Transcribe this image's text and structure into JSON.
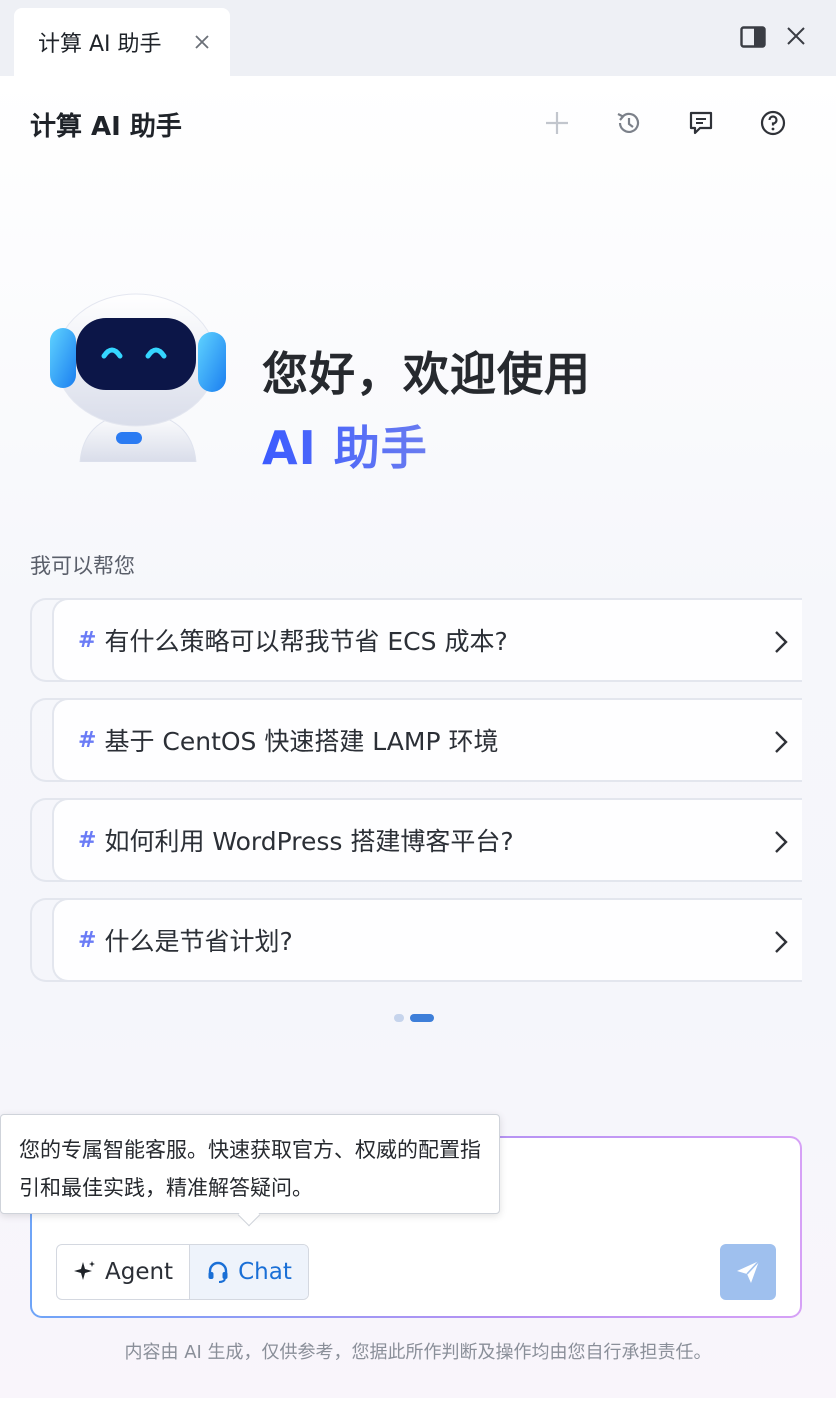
{
  "tab": {
    "title": "计算 AI 助手"
  },
  "header": {
    "title": "计算 AI 助手"
  },
  "welcome": {
    "line1": "您好，欢迎使用",
    "line2": "AI 助手"
  },
  "help_label": "我可以帮您",
  "suggestions": [
    {
      "hash": "#",
      "text": "有什么策略可以帮我节省 ECS 成本?"
    },
    {
      "hash": "#",
      "text": "基于 CentOS 快速搭建 LAMP 环境"
    },
    {
      "hash": "#",
      "text": "如何利用 WordPress 搭建博客平台?"
    },
    {
      "hash": "#",
      "text": "什么是节省计划?"
    }
  ],
  "pagination": {
    "pages": 2,
    "active": 2
  },
  "tooltip": {
    "text": "您的专属智能客服。快速获取官方、权威的配置指引和最佳实践，精准解答疑问。"
  },
  "modes": {
    "agent_label": "Agent",
    "chat_label": "Chat",
    "active": "Chat"
  },
  "disclaimer": "内容由 AI 生成，仅供参考，您据此所作判断及操作均由您自行承担责任。",
  "colors": {
    "accent": "#3e7fd9",
    "title_gradient_start": "#3b5bff",
    "send_disabled": "#9fc0ee"
  },
  "icons": [
    "close-icon",
    "panel-toggle-icon",
    "plus-icon",
    "history-icon",
    "feedback-icon",
    "help-icon",
    "chevron-right-icon",
    "sparkle-icon",
    "headset-icon",
    "send-icon"
  ]
}
